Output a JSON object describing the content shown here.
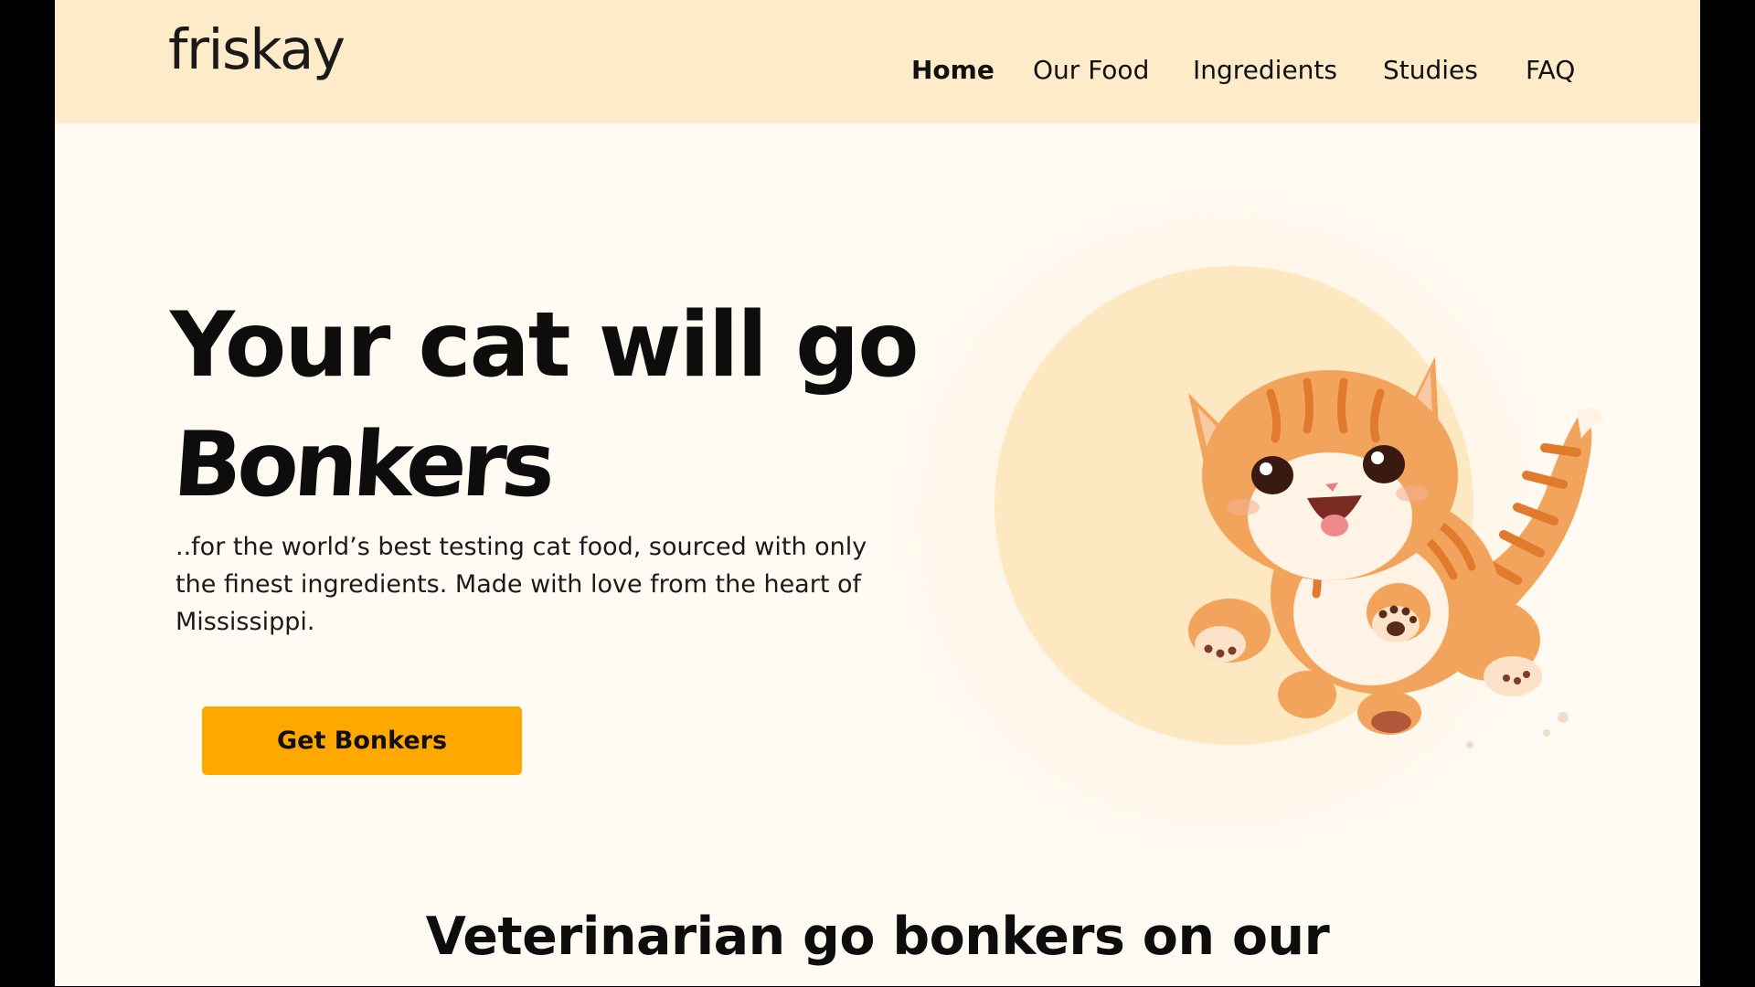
{
  "brand": {
    "logo_text": "friskay"
  },
  "nav": {
    "items": [
      {
        "label": "Home",
        "active": true
      },
      {
        "label": "Our Food",
        "active": false
      },
      {
        "label": "Ingredients",
        "active": false
      },
      {
        "label": "Studies",
        "active": false
      },
      {
        "label": "FAQ",
        "active": false
      }
    ]
  },
  "hero": {
    "title": "Your cat will go",
    "accent": "Bonkers",
    "description": "..for the world’s best testing cat food, sourced with only the finest ingredients. Made with love from the heart of Mississippi.",
    "cta_label": "Get Bonkers",
    "image_icon": "jumping-kitten-illustration"
  },
  "section": {
    "title": "Veterinarian go bonkers on our"
  },
  "colors": {
    "header_bg": "#fdebc9",
    "page_bg": "#fffaf2",
    "accent": "#ffa800",
    "circle": "#fde8c2",
    "text": "#0d0d0d"
  }
}
